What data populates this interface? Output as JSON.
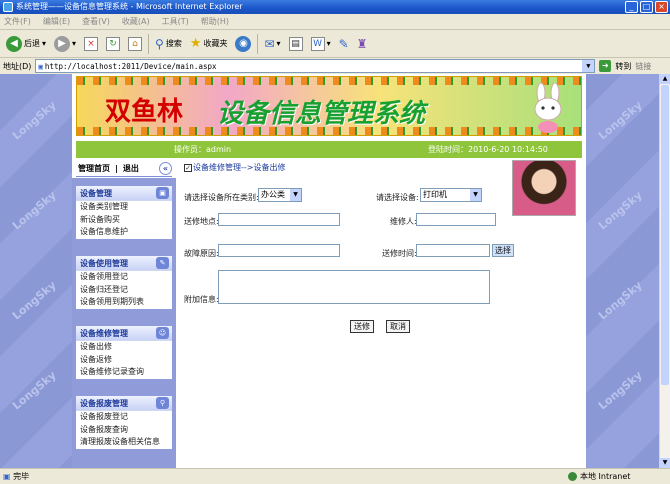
{
  "window": {
    "title": "系统管理——设备信息管理系统 - Microsoft Internet Explorer"
  },
  "menu": [
    "文件(F)",
    "编辑(E)",
    "查看(V)",
    "收藏(A)",
    "工具(T)",
    "帮助(H)"
  ],
  "toolbar": {
    "back": "后退",
    "search": "搜索",
    "favorites": "收藏夹"
  },
  "address": {
    "label": "地址(D)",
    "url": "http://localhost:2011/Device/main.aspx",
    "go": "转到",
    "links": "链接"
  },
  "watermark": "LongSky",
  "banner": {
    "part1": "双鱼林",
    "part2": "设备信息管理系统"
  },
  "infobar": {
    "operator": "操作员：admin",
    "login_time": "登陆时间：2010-6-20 10:14:50"
  },
  "sidebar": {
    "header_home": "管理首页",
    "header_sep": "|",
    "header_exit": "退出",
    "collapse": "«",
    "groups": [
      {
        "title": "设备管理",
        "items": [
          "设备类别管理",
          "新设备购买",
          "设备信息维护"
        ]
      },
      {
        "title": "设备使用管理",
        "items": [
          "设备领用登记",
          "设备归还登记",
          "设备领用到期列表"
        ]
      },
      {
        "title": "设备维修管理",
        "items": [
          "设备出修",
          "设备返修",
          "设备维修记录查询"
        ]
      },
      {
        "title": "设备报废管理",
        "items": [
          "设备报废登记",
          "设备报废查询",
          "清理报废设备相关信息"
        ]
      }
    ]
  },
  "form": {
    "breadcrumb": "设备维修管理-->设备出修",
    "category_label": "请选择设备所在类别:",
    "category_value": "办公类",
    "device_label": "请选择设备:",
    "device_value": "打印机",
    "place_label": "送修地点:",
    "repairer_label": "维修人:",
    "reason_label": "故障原因:",
    "time_label": "送修时间:",
    "choose_btn": "选择",
    "extra_label": "附加信息:",
    "submit_btn": "送修",
    "cancel_btn": "取消"
  },
  "status": {
    "text": "完毕",
    "zone": "本地 Intranet"
  }
}
